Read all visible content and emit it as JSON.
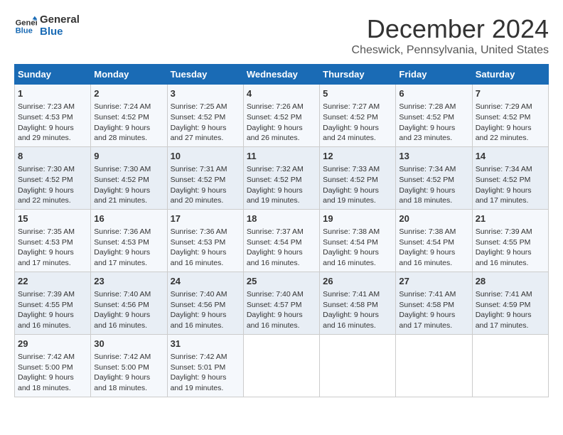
{
  "logo": {
    "line1": "General",
    "line2": "Blue"
  },
  "title": "December 2024",
  "subtitle": "Cheswick, Pennsylvania, United States",
  "days_of_week": [
    "Sunday",
    "Monday",
    "Tuesday",
    "Wednesday",
    "Thursday",
    "Friday",
    "Saturday"
  ],
  "weeks": [
    [
      {
        "day": "1",
        "sunrise": "7:23 AM",
        "sunset": "4:53 PM",
        "daylight": "9 hours and 29 minutes."
      },
      {
        "day": "2",
        "sunrise": "7:24 AM",
        "sunset": "4:52 PM",
        "daylight": "9 hours and 28 minutes."
      },
      {
        "day": "3",
        "sunrise": "7:25 AM",
        "sunset": "4:52 PM",
        "daylight": "9 hours and 27 minutes."
      },
      {
        "day": "4",
        "sunrise": "7:26 AM",
        "sunset": "4:52 PM",
        "daylight": "9 hours and 26 minutes."
      },
      {
        "day": "5",
        "sunrise": "7:27 AM",
        "sunset": "4:52 PM",
        "daylight": "9 hours and 24 minutes."
      },
      {
        "day": "6",
        "sunrise": "7:28 AM",
        "sunset": "4:52 PM",
        "daylight": "9 hours and 23 minutes."
      },
      {
        "day": "7",
        "sunrise": "7:29 AM",
        "sunset": "4:52 PM",
        "daylight": "9 hours and 22 minutes."
      }
    ],
    [
      {
        "day": "8",
        "sunrise": "7:30 AM",
        "sunset": "4:52 PM",
        "daylight": "9 hours and 22 minutes."
      },
      {
        "day": "9",
        "sunrise": "7:30 AM",
        "sunset": "4:52 PM",
        "daylight": "9 hours and 21 minutes."
      },
      {
        "day": "10",
        "sunrise": "7:31 AM",
        "sunset": "4:52 PM",
        "daylight": "9 hours and 20 minutes."
      },
      {
        "day": "11",
        "sunrise": "7:32 AM",
        "sunset": "4:52 PM",
        "daylight": "9 hours and 19 minutes."
      },
      {
        "day": "12",
        "sunrise": "7:33 AM",
        "sunset": "4:52 PM",
        "daylight": "9 hours and 19 minutes."
      },
      {
        "day": "13",
        "sunrise": "7:34 AM",
        "sunset": "4:52 PM",
        "daylight": "9 hours and 18 minutes."
      },
      {
        "day": "14",
        "sunrise": "7:34 AM",
        "sunset": "4:52 PM",
        "daylight": "9 hours and 17 minutes."
      }
    ],
    [
      {
        "day": "15",
        "sunrise": "7:35 AM",
        "sunset": "4:53 PM",
        "daylight": "9 hours and 17 minutes."
      },
      {
        "day": "16",
        "sunrise": "7:36 AM",
        "sunset": "4:53 PM",
        "daylight": "9 hours and 17 minutes."
      },
      {
        "day": "17",
        "sunrise": "7:36 AM",
        "sunset": "4:53 PM",
        "daylight": "9 hours and 16 minutes."
      },
      {
        "day": "18",
        "sunrise": "7:37 AM",
        "sunset": "4:54 PM",
        "daylight": "9 hours and 16 minutes."
      },
      {
        "day": "19",
        "sunrise": "7:38 AM",
        "sunset": "4:54 PM",
        "daylight": "9 hours and 16 minutes."
      },
      {
        "day": "20",
        "sunrise": "7:38 AM",
        "sunset": "4:54 PM",
        "daylight": "9 hours and 16 minutes."
      },
      {
        "day": "21",
        "sunrise": "7:39 AM",
        "sunset": "4:55 PM",
        "daylight": "9 hours and 16 minutes."
      }
    ],
    [
      {
        "day": "22",
        "sunrise": "7:39 AM",
        "sunset": "4:55 PM",
        "daylight": "9 hours and 16 minutes."
      },
      {
        "day": "23",
        "sunrise": "7:40 AM",
        "sunset": "4:56 PM",
        "daylight": "9 hours and 16 minutes."
      },
      {
        "day": "24",
        "sunrise": "7:40 AM",
        "sunset": "4:56 PM",
        "daylight": "9 hours and 16 minutes."
      },
      {
        "day": "25",
        "sunrise": "7:40 AM",
        "sunset": "4:57 PM",
        "daylight": "9 hours and 16 minutes."
      },
      {
        "day": "26",
        "sunrise": "7:41 AM",
        "sunset": "4:58 PM",
        "daylight": "9 hours and 16 minutes."
      },
      {
        "day": "27",
        "sunrise": "7:41 AM",
        "sunset": "4:58 PM",
        "daylight": "9 hours and 17 minutes."
      },
      {
        "day": "28",
        "sunrise": "7:41 AM",
        "sunset": "4:59 PM",
        "daylight": "9 hours and 17 minutes."
      }
    ],
    [
      {
        "day": "29",
        "sunrise": "7:42 AM",
        "sunset": "5:00 PM",
        "daylight": "9 hours and 18 minutes."
      },
      {
        "day": "30",
        "sunrise": "7:42 AM",
        "sunset": "5:00 PM",
        "daylight": "9 hours and 18 minutes."
      },
      {
        "day": "31",
        "sunrise": "7:42 AM",
        "sunset": "5:01 PM",
        "daylight": "9 hours and 19 minutes."
      },
      null,
      null,
      null,
      null
    ]
  ],
  "labels": {
    "sunrise": "Sunrise:",
    "sunset": "Sunset:",
    "daylight": "Daylight:"
  }
}
